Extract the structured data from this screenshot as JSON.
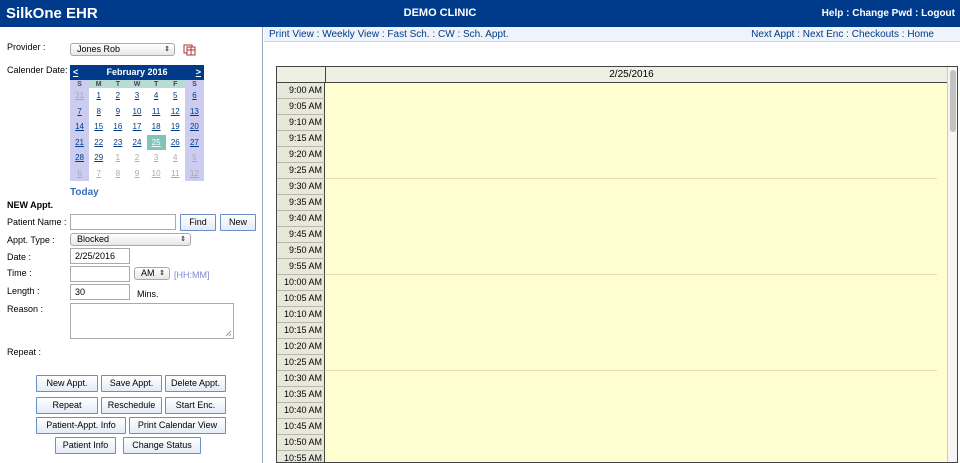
{
  "topbar": {
    "logo": "SilkOne  EHR",
    "clinic": "DEMO  CLINIC",
    "help": "Help",
    "change_pwd": "Change Pwd",
    "logout": "Logout",
    "sep": " : "
  },
  "nav": {
    "left": [
      "Print View",
      "Weekly View",
      "Fast Sch.",
      "CW",
      "Sch. Appt."
    ],
    "right": [
      "Next Appt",
      "Next Enc",
      "Checkouts",
      "Home"
    ]
  },
  "form": {
    "provider_label": "Provider :",
    "provider_value": "Jones Rob",
    "calendar_label": "Calender Date:",
    "today": "Today",
    "new_appt": "NEW Appt.",
    "patient_name_label": "Patient Name :",
    "patient_name_value": "",
    "find": "Find",
    "new": "New",
    "appt_type_label": "Appt. Type :",
    "appt_type_value": "Blocked",
    "date_label": "Date :",
    "date_value": "2/25/2016",
    "time_label": "Time :",
    "time_value": "",
    "ampm": "AM",
    "time_hint": "[HH:MM]",
    "length_label": "Length :",
    "length_value": "30",
    "mins": "Mins.",
    "reason_label": "Reason :",
    "repeat_label": "Repeat :"
  },
  "calendar": {
    "prev": "<",
    "next": ">",
    "month": "February 2016",
    "dow": [
      "S",
      "M",
      "T",
      "W",
      "T",
      "F",
      "S"
    ],
    "weeks": [
      [
        "31",
        "1",
        "2",
        "3",
        "4",
        "5",
        "6"
      ],
      [
        "7",
        "8",
        "9",
        "10",
        "11",
        "12",
        "13"
      ],
      [
        "14",
        "15",
        "16",
        "17",
        "18",
        "19",
        "20"
      ],
      [
        "21",
        "22",
        "23",
        "24",
        "25",
        "26",
        "27"
      ],
      [
        "28",
        "29",
        "1",
        "2",
        "3",
        "4",
        "5"
      ],
      [
        "6",
        "7",
        "8",
        "9",
        "10",
        "11",
        "12"
      ]
    ],
    "selected": "25"
  },
  "buttons": {
    "new_appt": "New Appt.",
    "save_appt": "Save Appt.",
    "delete_appt": "Delete Appt.",
    "repeat": "Repeat",
    "reschedule": "Reschedule",
    "start_enc": "Start Enc.",
    "patient_appt_info": "Patient-Appt. Info",
    "print_calendar_view": "Print Calendar View",
    "patient_info": "Patient Info",
    "change_status": "Change Status"
  },
  "schedule": {
    "date": "2/25/2016",
    "times": [
      "9:00 AM",
      "9:05 AM",
      "9:10 AM",
      "9:15 AM",
      "9:20 AM",
      "9:25 AM",
      "9:30 AM",
      "9:35 AM",
      "9:40 AM",
      "9:45 AM",
      "9:50 AM",
      "9:55 AM",
      "10:00 AM",
      "10:05 AM",
      "10:10 AM",
      "10:15 AM",
      "10:20 AM",
      "10:25 AM",
      "10:30 AM",
      "10:35 AM",
      "10:40 AM",
      "10:45 AM",
      "10:50 AM",
      "10:55 AM"
    ]
  }
}
